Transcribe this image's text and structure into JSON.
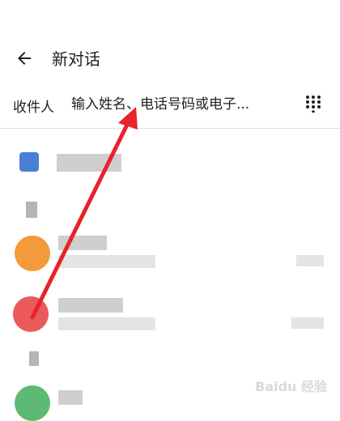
{
  "header": {
    "title": "新对话",
    "back_icon": "arrow-left-icon"
  },
  "recipient": {
    "label": "收件人",
    "placeholder": "输入姓名、电话号码或电子...",
    "dialpad_icon": "dialpad-icon"
  },
  "colors": {
    "avatar_blue": "#4a7fd6",
    "avatar_orange": "#f39a3a",
    "avatar_red": "#ea5a5a",
    "avatar_green": "#5cba73",
    "annotation_arrow": "#e8232a"
  },
  "watermark": "Baidu 经验"
}
